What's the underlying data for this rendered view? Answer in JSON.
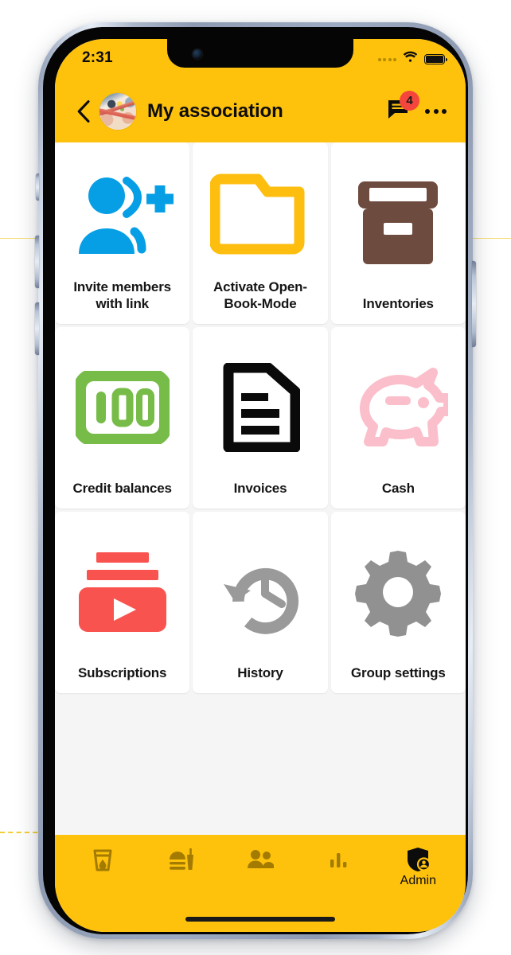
{
  "status_bar": {
    "time": "2:31",
    "signal_icon": "signal-dots-icon",
    "signal_dots": 4,
    "wifi_icon": "wifi-icon",
    "battery_icon": "battery-full-icon",
    "battery_level_percent": 100
  },
  "app_bar": {
    "back_icon": "chevron-left-icon",
    "avatar_name": "group-avatar",
    "title": "My association",
    "chat_icon": "chat-bubble-icon",
    "chat_badge_count": "4",
    "overflow_icon": "more-options-icon"
  },
  "colors": {
    "brand_yellow": "#FEC20D",
    "badge_red": "#F4463C",
    "tile_bg": "#FFFFFF",
    "content_bg": "#F5F5F5",
    "invite_blue": "#069FE5",
    "folder_yellow": "#FEBE10",
    "inventory_brown": "#6E4B3F",
    "credit_green": "#77BC48",
    "invoice_black": "#0A0A0A",
    "cash_pink": "#FBBFCB",
    "subscriptions_red": "#F9534F",
    "history_gray": "#9A9A9A",
    "settings_gray": "#919191",
    "nav_inactive": "#A37B00",
    "nav_active": "#0C0C0C"
  },
  "grid": {
    "tiles": [
      {
        "label": "Invite members with link",
        "icon": "person-add-icon"
      },
      {
        "label": "Activate Open-Book-Mode",
        "icon": "open-folder-icon"
      },
      {
        "label": "Inventories",
        "icon": "inventory-box-icon"
      },
      {
        "label": "Credit balances",
        "icon": "credit-100-icon"
      },
      {
        "label": "Invoices",
        "icon": "document-invoice-icon"
      },
      {
        "label": "Cash",
        "icon": "piggy-bank-icon"
      },
      {
        "label": "Subscriptions",
        "icon": "subscriptions-play-icon"
      },
      {
        "label": "History",
        "icon": "history-clock-icon"
      },
      {
        "label": "Group settings",
        "icon": "gear-icon"
      }
    ]
  },
  "bottom_nav": {
    "items": [
      {
        "label": "",
        "icon": "drink-glass-icon",
        "active": false
      },
      {
        "label": "",
        "icon": "food-burger-icon",
        "active": false
      },
      {
        "label": "",
        "icon": "people-icon",
        "active": false
      },
      {
        "label": "",
        "icon": "bar-chart-icon",
        "active": false
      },
      {
        "label": "Admin",
        "icon": "shield-admin-icon",
        "active": true
      }
    ]
  }
}
